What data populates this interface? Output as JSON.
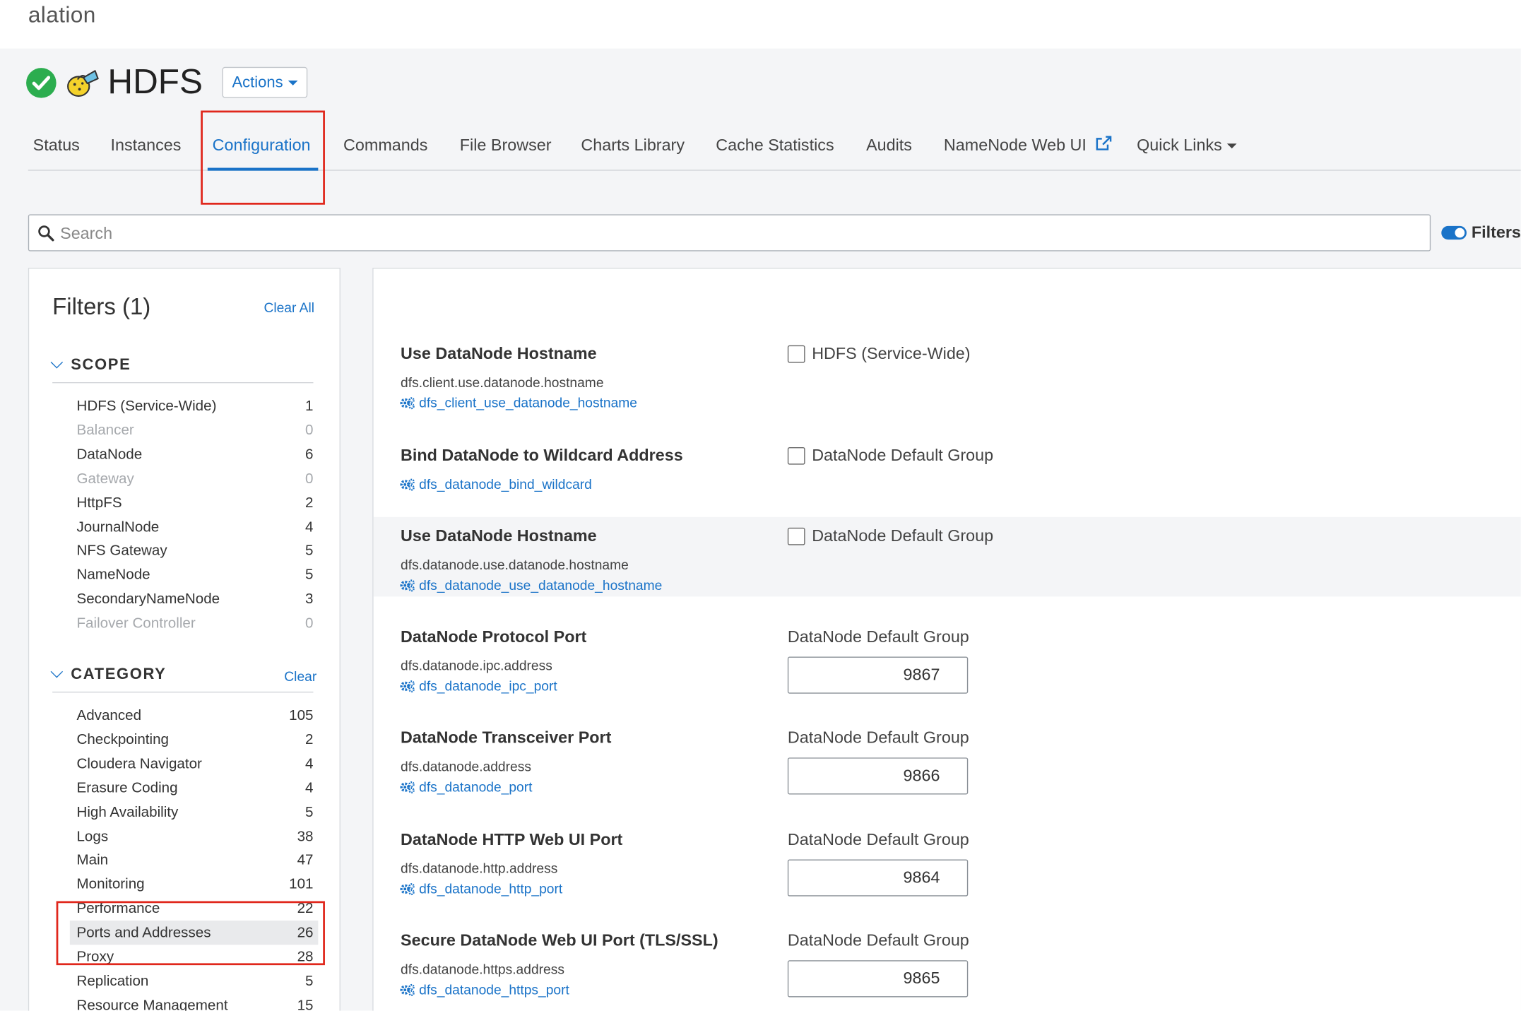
{
  "brand": "alation",
  "service": {
    "name": "HDFS",
    "actions_label": "Actions"
  },
  "tabs": [
    {
      "label": "Status"
    },
    {
      "label": "Instances"
    },
    {
      "label": "Configuration"
    },
    {
      "label": "Commands"
    },
    {
      "label": "File Browser"
    },
    {
      "label": "Charts Library"
    },
    {
      "label": "Cache Statistics"
    },
    {
      "label": "Audits"
    },
    {
      "label": "NameNode Web UI"
    },
    {
      "label": "Quick Links"
    }
  ],
  "active_tab": "Configuration",
  "search": {
    "placeholder": "Search",
    "value": ""
  },
  "filters_toggle_label": "Filters",
  "filters": {
    "title": "Filters (1)",
    "clear_all": "Clear All",
    "scope": {
      "heading": "SCOPE",
      "items": [
        {
          "label": "HDFS (Service-Wide)",
          "count": "1"
        },
        {
          "label": "Balancer",
          "count": "0"
        },
        {
          "label": "DataNode",
          "count": "6"
        },
        {
          "label": "Gateway",
          "count": "0"
        },
        {
          "label": "HttpFS",
          "count": "2"
        },
        {
          "label": "JournalNode",
          "count": "4"
        },
        {
          "label": "NFS Gateway",
          "count": "5"
        },
        {
          "label": "NameNode",
          "count": "5"
        },
        {
          "label": "SecondaryNameNode",
          "count": "3"
        },
        {
          "label": "Failover Controller",
          "count": "0"
        }
      ]
    },
    "category": {
      "heading": "CATEGORY",
      "clear": "Clear",
      "items": [
        {
          "label": "Advanced",
          "count": "105"
        },
        {
          "label": "Checkpointing",
          "count": "2"
        },
        {
          "label": "Cloudera Navigator",
          "count": "4"
        },
        {
          "label": "Erasure Coding",
          "count": "4"
        },
        {
          "label": "High Availability",
          "count": "5"
        },
        {
          "label": "Logs",
          "count": "38"
        },
        {
          "label": "Main",
          "count": "47"
        },
        {
          "label": "Monitoring",
          "count": "101"
        },
        {
          "label": "Performance",
          "count": "22"
        },
        {
          "label": "Ports and Addresses",
          "count": "26"
        },
        {
          "label": "Proxy",
          "count": "28"
        },
        {
          "label": "Replication",
          "count": "5"
        },
        {
          "label": "Resource Management",
          "count": "15"
        }
      ],
      "selected": "Ports and Addresses"
    }
  },
  "configs": [
    {
      "title": "Use DataNode Hostname",
      "property": "dfs.client.use.datanode.hostname",
      "param": "dfs_client_use_datanode_hostname",
      "scope": "HDFS (Service-Wide)",
      "checked": false
    },
    {
      "title": "Bind DataNode to Wildcard Address",
      "property": "",
      "param": "dfs_datanode_bind_wildcard",
      "scope": "DataNode Default Group",
      "checked": false
    },
    {
      "title": "Use DataNode Hostname",
      "property": "dfs.datanode.use.datanode.hostname",
      "param": "dfs_datanode_use_datanode_hostname",
      "scope": "DataNode Default Group",
      "checked": false
    },
    {
      "title": "DataNode Protocol Port",
      "property": "dfs.datanode.ipc.address",
      "param": "dfs_datanode_ipc_port",
      "scope": "DataNode Default Group",
      "value": "9867"
    },
    {
      "title": "DataNode Transceiver Port",
      "property": "dfs.datanode.address",
      "param": "dfs_datanode_port",
      "scope": "DataNode Default Group",
      "value": "9866"
    },
    {
      "title": "DataNode HTTP Web UI Port",
      "property": "dfs.datanode.http.address",
      "param": "dfs_datanode_http_port",
      "scope": "DataNode Default Group",
      "value": "9864"
    },
    {
      "title": "Secure DataNode Web UI Port (TLS/SSL)",
      "property": "dfs.datanode.https.address",
      "param": "dfs_datanode_https_port",
      "scope": "DataNode Default Group",
      "value": "9865"
    }
  ],
  "colors": {
    "accent": "#1a73c8",
    "status_ok": "#2cad4f",
    "highlight_box": "#e0271c"
  },
  "icons": [
    "check-circle-icon",
    "hdfs-logo-icon",
    "search-icon",
    "external-link-icon",
    "gear-icon",
    "chevron-down-icon"
  ]
}
